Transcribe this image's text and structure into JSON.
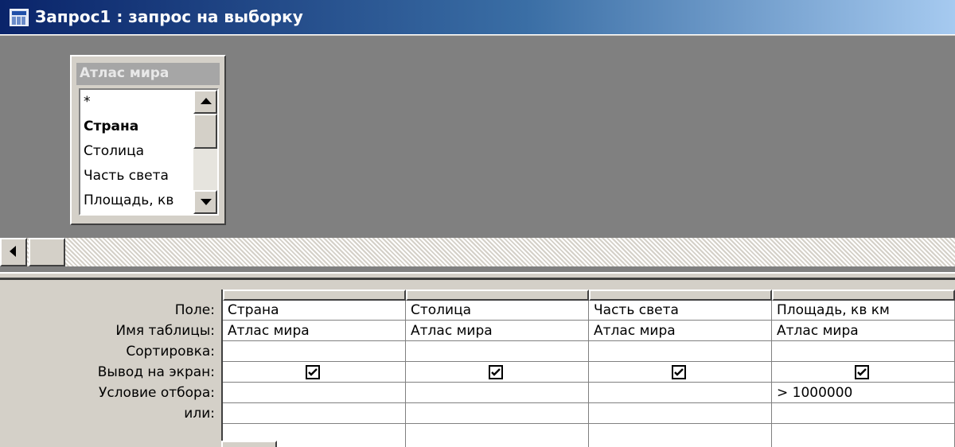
{
  "window": {
    "title": "Запрос1 : запрос на выборку"
  },
  "table_box": {
    "title": "Атлас мира",
    "fields": [
      "*",
      "Страна",
      "Столица",
      "Часть света",
      "Площадь, кв"
    ]
  },
  "grid": {
    "row_labels": [
      "Поле:",
      "Имя таблицы:",
      "Сортировка:",
      "Вывод на экран:",
      "Условие отбора:",
      "или:"
    ],
    "columns": [
      {
        "field": "Страна",
        "table": "Атлас мира",
        "sort": "",
        "show": true,
        "criteria": "",
        "or": ""
      },
      {
        "field": "Столица",
        "table": "Атлас мира",
        "sort": "",
        "show": true,
        "criteria": "",
        "or": ""
      },
      {
        "field": "Часть света",
        "table": "Атлас мира",
        "sort": "",
        "show": true,
        "criteria": "",
        "or": ""
      },
      {
        "field": "Площадь, кв км",
        "table": "Атлас мира",
        "sort": "",
        "show": true,
        "criteria": "> 1000000",
        "or": ""
      }
    ]
  },
  "colors": {
    "titlebar_start": "#0a246a",
    "titlebar_end": "#a6caf0",
    "pane_background": "#808080",
    "face": "#d4d0c8"
  },
  "icons": {
    "title": "query-icon",
    "scroll_up": "arrow-up-icon",
    "scroll_down": "arrow-down-icon",
    "scroll_left": "arrow-left-icon",
    "check": "checkmark-icon"
  }
}
